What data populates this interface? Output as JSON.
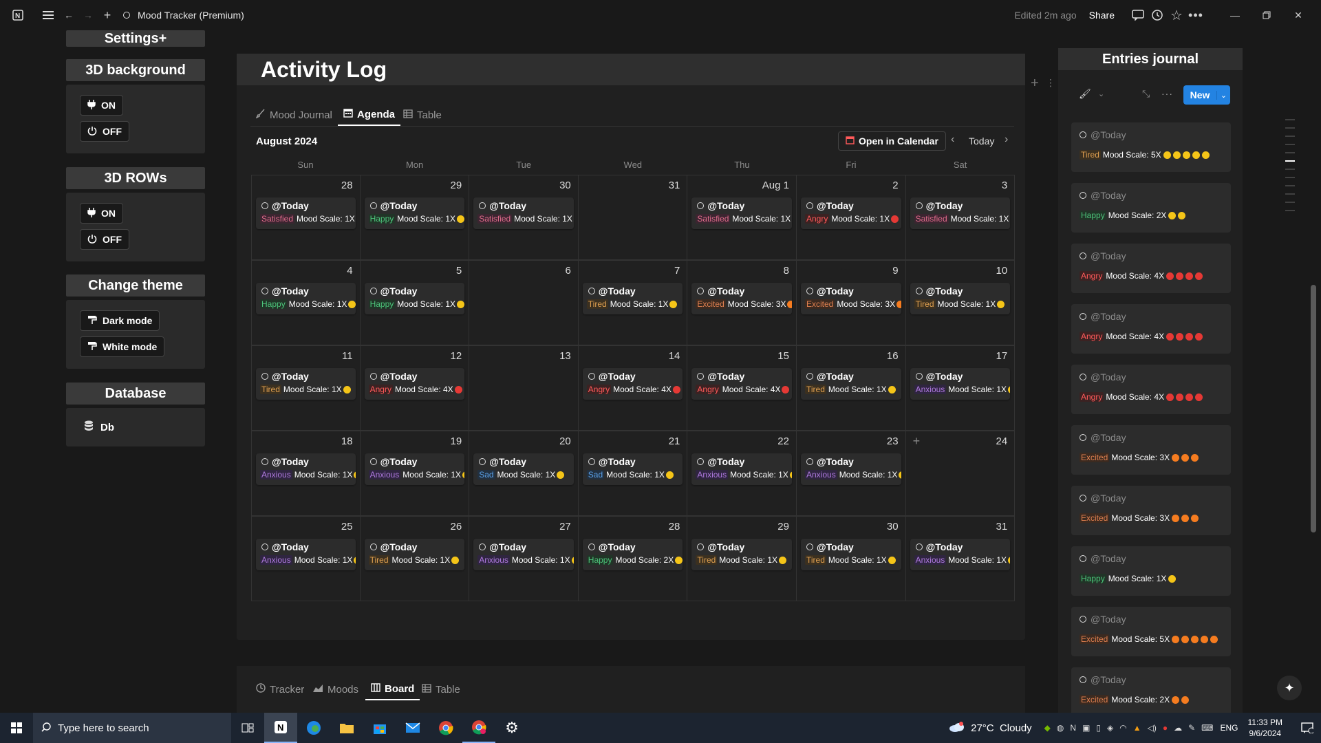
{
  "window": {
    "title": "Mood Tracker (Premium)",
    "edited": "Edited 2m ago",
    "share": "Share"
  },
  "sidebar": {
    "settings_title": "Settings+",
    "bg_title": "3D background",
    "bg_on": "ON",
    "bg_off": "OFF",
    "rows_title": "3D ROWs",
    "rows_on": "ON",
    "rows_off": "OFF",
    "theme_title": "Change theme",
    "dark": "Dark mode",
    "white": "White mode",
    "db_title": "Database",
    "db": "Db"
  },
  "main": {
    "title": "Activity Log",
    "tabs": [
      "Mood Journal",
      "Agenda",
      "Table"
    ],
    "month": "August 2024",
    "open_calendar": "Open in Calendar",
    "today": "Today",
    "days": [
      "Sun",
      "Mon",
      "Tue",
      "Wed",
      "Thu",
      "Fri",
      "Sat"
    ],
    "today_label": "@Today",
    "scale_label": "Mood Scale:",
    "bottom_tabs": [
      "Tracker",
      "Moods",
      "Board",
      "Table"
    ]
  },
  "mood_colors": {
    "Satisfied": {
      "fg": "#e06c8c",
      "bg": "#3b2530"
    },
    "Happy": {
      "fg": "#4cc47a",
      "bg": "#213427"
    },
    "Angry": {
      "fg": "#ff5a5a",
      "bg": "#3b2222"
    },
    "Tired": {
      "fg": "#e0a050",
      "bg": "#3b3020"
    },
    "Excited": {
      "fg": "#e08050",
      "bg": "#3b2a20"
    },
    "Anxious": {
      "fg": "#b07ae0",
      "bg": "#2f2540"
    },
    "Sad": {
      "fg": "#5aa0e8",
      "bg": "#22303f"
    }
  },
  "weeks": [
    [
      {
        "day": "28",
        "mood": "Satisfied",
        "scale": "1X"
      },
      {
        "day": "29",
        "mood": "Happy",
        "scale": "1X"
      },
      {
        "day": "30",
        "mood": "Satisfied",
        "scale": "1X"
      },
      {
        "day": "31"
      },
      {
        "day": "Aug 1",
        "mood": "Satisfied",
        "scale": "1X"
      },
      {
        "day": "2",
        "mood": "Angry",
        "scale": "1X"
      },
      {
        "day": "3",
        "mood": "Satisfied",
        "scale": "1X"
      }
    ],
    [
      {
        "day": "4",
        "mood": "Happy",
        "scale": "1X"
      },
      {
        "day": "5",
        "mood": "Happy",
        "scale": "1X"
      },
      {
        "day": "6"
      },
      {
        "day": "7",
        "mood": "Tired",
        "scale": "1X"
      },
      {
        "day": "8",
        "mood": "Excited",
        "scale": "3X"
      },
      {
        "day": "9",
        "mood": "Excited",
        "scale": "3X"
      },
      {
        "day": "10",
        "mood": "Tired",
        "scale": "1X"
      }
    ],
    [
      {
        "day": "11",
        "mood": "Tired",
        "scale": "1X"
      },
      {
        "day": "12",
        "mood": "Angry",
        "scale": "4X"
      },
      {
        "day": "13"
      },
      {
        "day": "14",
        "mood": "Angry",
        "scale": "4X"
      },
      {
        "day": "15",
        "mood": "Angry",
        "scale": "4X"
      },
      {
        "day": "16",
        "mood": "Tired",
        "scale": "1X"
      },
      {
        "day": "17",
        "mood": "Anxious",
        "scale": "1X"
      }
    ],
    [
      {
        "day": "18",
        "mood": "Anxious",
        "scale": "1X"
      },
      {
        "day": "19",
        "mood": "Anxious",
        "scale": "1X"
      },
      {
        "day": "20",
        "mood": "Sad",
        "scale": "1X"
      },
      {
        "day": "21",
        "mood": "Sad",
        "scale": "1X"
      },
      {
        "day": "22",
        "mood": "Anxious",
        "scale": "1X"
      },
      {
        "day": "23",
        "mood": "Anxious",
        "scale": "1X"
      },
      {
        "day": "24"
      }
    ],
    [
      {
        "day": "25",
        "mood": "Anxious",
        "scale": "1X"
      },
      {
        "day": "26",
        "mood": "Tired",
        "scale": "1X"
      },
      {
        "day": "27",
        "mood": "Anxious",
        "scale": "1X"
      },
      {
        "day": "28",
        "mood": "Happy",
        "scale": "2X"
      },
      {
        "day": "29",
        "mood": "Tired",
        "scale": "1X"
      },
      {
        "day": "30",
        "mood": "Tired",
        "scale": "1X"
      },
      {
        "day": "31",
        "mood": "Anxious",
        "scale": "1X"
      }
    ]
  ],
  "journal": {
    "title": "Entries journal",
    "new_label": "New",
    "entries": [
      {
        "mood": "Tired",
        "scale": "5X",
        "n": 5
      },
      {
        "mood": "Happy",
        "scale": "2X",
        "n": 2
      },
      {
        "mood": "Angry",
        "scale": "4X",
        "n": 4
      },
      {
        "mood": "Angry",
        "scale": "4X",
        "n": 4
      },
      {
        "mood": "Angry",
        "scale": "4X",
        "n": 4
      },
      {
        "mood": "Excited",
        "scale": "3X",
        "n": 3
      },
      {
        "mood": "Excited",
        "scale": "3X",
        "n": 3
      },
      {
        "mood": "Happy",
        "scale": "1X",
        "n": 1
      },
      {
        "mood": "Excited",
        "scale": "5X",
        "n": 5
      },
      {
        "mood": "Excited",
        "scale": "2X",
        "n": 2
      }
    ]
  },
  "taskbar": {
    "search_placeholder": "Type here to search",
    "weather": "27°C  Cloudy",
    "lang": "ENG",
    "time": "11:33 PM",
    "date": "9/6/2024"
  }
}
